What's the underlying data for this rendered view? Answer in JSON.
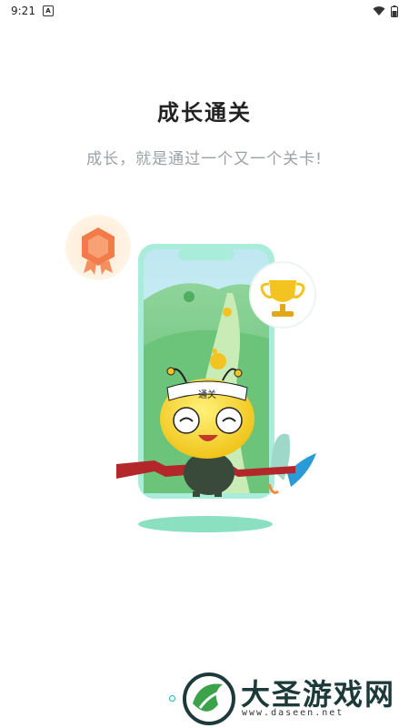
{
  "status_bar": {
    "time": "9:21",
    "notification_icon": "a-badge-icon",
    "wifi_icon": "wifi-icon",
    "battery_icon": "battery-icon"
  },
  "onboarding": {
    "title": "成长通关",
    "subtitle": "成长，就是通过一个又一个关卡!",
    "mascot_headband": "通关",
    "page_indicator": {
      "current": 1
    }
  },
  "watermark": {
    "name": "大圣游戏网",
    "url": "www.daseen.net"
  },
  "colors": {
    "accent": "#21b6a8",
    "ribbon": "#b3262a",
    "mascot": "#f5d11b"
  }
}
